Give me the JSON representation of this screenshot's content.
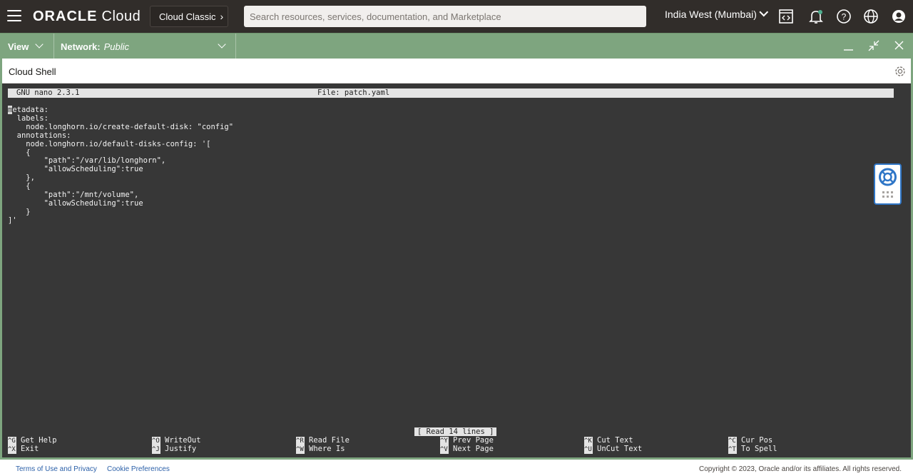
{
  "topbar": {
    "brand_main": "ORACLE",
    "brand_sub": "Cloud",
    "classic_label": "Cloud Classic",
    "search_placeholder": "Search resources, services, documentation, and Marketplace",
    "region": "India West (Mumbai)",
    "icons": [
      "menu-icon",
      "code-editor-icon",
      "bell-icon",
      "help-icon",
      "globe-icon",
      "user-icon"
    ]
  },
  "shellbar": {
    "view_label": "View",
    "network_label": "Network:",
    "network_value": "Public",
    "controls": [
      "minimize-icon",
      "restore-icon",
      "close-icon"
    ]
  },
  "panel": {
    "title": "Cloud Shell"
  },
  "nano": {
    "version": "GNU nano 2.3.1",
    "file": "File: patch.yaml",
    "cursor_char": "m",
    "lines": [
      "etadata:",
      "  labels:",
      "    node.longhorn.io/create-default-disk: \"config\"",
      "  annotations:",
      "    node.longhorn.io/default-disks-config: '[",
      "    {",
      "        \"path\":\"/var/lib/longhorn\",",
      "        \"allowScheduling\":true",
      "    },",
      "    {",
      "        \"path\":\"/mnt/volume\",",
      "        \"allowScheduling\":true",
      "    }",
      "]'"
    ],
    "status": "[ Read 14 lines ]",
    "shortcuts": [
      {
        "key": "^G",
        "label": "Get Help"
      },
      {
        "key": "^X",
        "label": "Exit"
      },
      {
        "key": "^O",
        "label": "WriteOut"
      },
      {
        "key": "^J",
        "label": "Justify"
      },
      {
        "key": "^R",
        "label": "Read File"
      },
      {
        "key": "^W",
        "label": "Where Is"
      },
      {
        "key": "^Y",
        "label": "Prev Page"
      },
      {
        "key": "^V",
        "label": "Next Page"
      },
      {
        "key": "^K",
        "label": "Cut Text"
      },
      {
        "key": "^U",
        "label": "UnCut Text"
      },
      {
        "key": "^C",
        "label": "Cur Pos"
      },
      {
        "key": "^T",
        "label": "To Spell"
      }
    ]
  },
  "footer": {
    "terms": "Terms of Use and Privacy",
    "cookies": "Cookie Preferences",
    "copyright": "Copyright © 2023, Oracle and/or its affiliates. All rights reserved."
  },
  "colors": {
    "topbar_bg": "#312d2a",
    "shell_green": "#7ea57f",
    "terminal_bg": "#373737",
    "link_blue": "#2a5fa8"
  }
}
